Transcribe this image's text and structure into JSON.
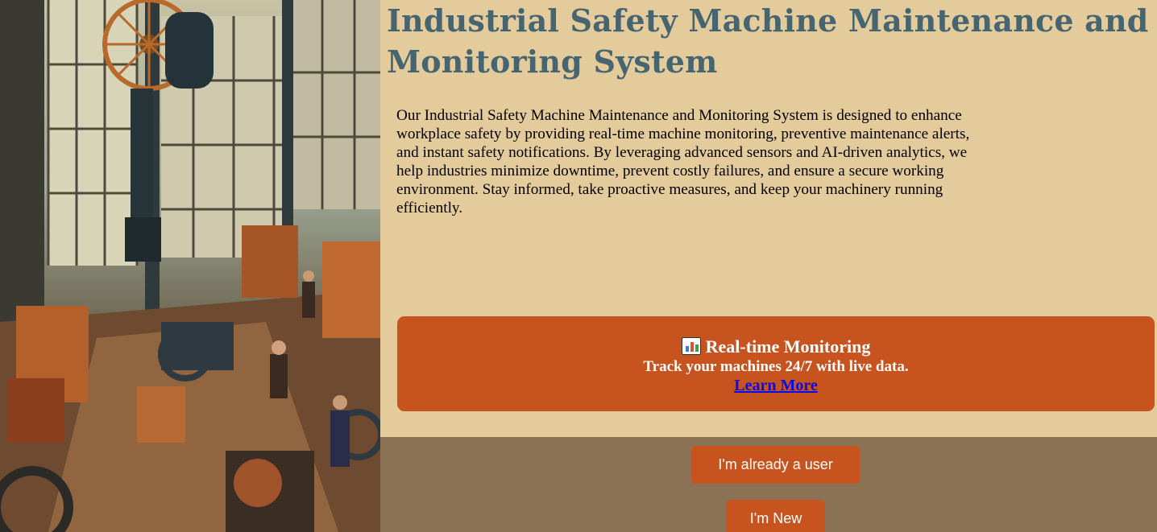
{
  "header": {
    "title": "Industrial Safety Machine Maintenance and Monitoring System"
  },
  "intro": {
    "text": "Our Industrial Safety Machine Maintenance and Monitoring System is designed to enhance workplace safety by providing real-time machine monitoring, preventive maintenance alerts, and instant safety notifications. By leveraging advanced sensors and AI-driven analytics, we help industries minimize downtime, prevent costly failures, and ensure a secure working environment. Stay informed, take proactive measures, and keep your machinery running efficiently."
  },
  "feature": {
    "icon": "bar-chart-icon",
    "title": "Real-time Monitoring",
    "subtitle": "Track your machines 24/7 with live data.",
    "link_label": "Learn More"
  },
  "auth": {
    "existing_user_label": "I'm already a user",
    "new_user_label": "I'm New"
  },
  "colors": {
    "background": "#e3cb9c",
    "title": "#476570",
    "accent": "#c7531e",
    "footer": "#8c7255",
    "link": "#0a0ae6"
  },
  "hero_image": {
    "icon": "factory-illustration"
  }
}
